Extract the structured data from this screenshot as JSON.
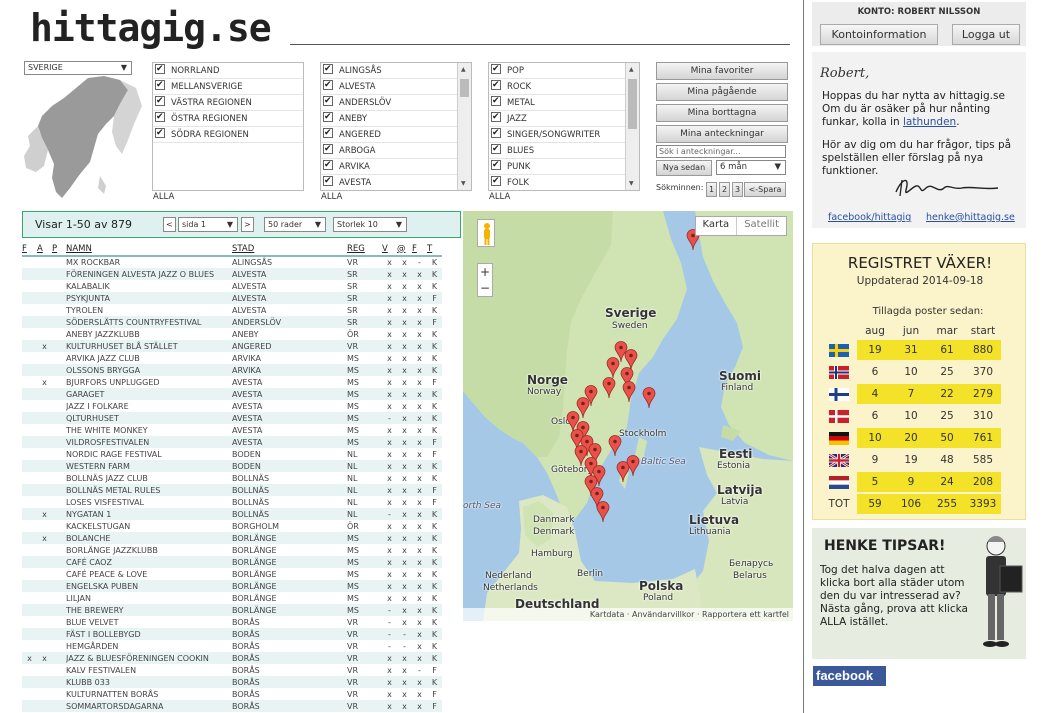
{
  "logo": "hittagig.se",
  "country_select": "SVERIGE",
  "regions": [
    "NORRLAND",
    "MELLANSVERIGE",
    "VÄSTRA REGIONEN",
    "ÖSTRA REGIONEN",
    "SÖDRA REGIONEN"
  ],
  "cities": [
    "ALINGSÅS",
    "ALVESTA",
    "ANDERSLÖV",
    "ANEBY",
    "ANGERED",
    "ARBOGA",
    "ARVIKA",
    "AVESTA"
  ],
  "genres": [
    "POP",
    "ROCK",
    "METAL",
    "JAZZ",
    "SINGER/SONGWRITER",
    "BLUES",
    "PUNK",
    "FOLK"
  ],
  "alla": "ALLA",
  "side_buttons": [
    "Mina favoriter",
    "Mina pågående",
    "Mina borttagna",
    "Mina anteckningar"
  ],
  "notes_search_placeholder": "Sök i anteckningar...",
  "nya_sedan": "Nya sedan",
  "period_select": "6 mån",
  "sokminnen_label": "Sökminnen:",
  "sokminnen_pages": [
    "1",
    "2",
    "3"
  ],
  "spara": "<-Spara",
  "listbar": {
    "showing": "Visar 1-50 av 879",
    "prev": "<",
    "page": "sida 1",
    "next": ">",
    "rows": "50 rader",
    "size": "Storlek 10"
  },
  "table_headers": [
    "F",
    "A",
    "P",
    "NAMN",
    "STAD",
    "REG",
    "V",
    "@",
    "F",
    "T"
  ],
  "gigs": [
    [
      "",
      "",
      "",
      "MX ROCKBAR",
      "ALINGSÅS",
      "VR",
      "x",
      "x",
      "-",
      "x",
      "K"
    ],
    [
      "",
      "",
      "",
      "FÖRENINGEN ALVESTA JAZZ O BLUES",
      "ALVESTA",
      "SR",
      "x",
      "x",
      "x",
      "x",
      "K"
    ],
    [
      "",
      "",
      "",
      "KALABALIK",
      "ALVESTA",
      "SR",
      "x",
      "x",
      "x",
      "-",
      "K"
    ],
    [
      "",
      "",
      "",
      "PSYKJUNTA",
      "ALVESTA",
      "SR",
      "x",
      "x",
      "x",
      "-",
      "F"
    ],
    [
      "",
      "",
      "",
      "TYROLEN",
      "ALVESTA",
      "SR",
      "x",
      "x",
      "x",
      "X",
      "K"
    ],
    [
      "",
      "",
      "",
      "SÖDERSLÄTTS COUNTRYFESTIVAL",
      "ANDERSLÖV",
      "SR",
      "x",
      "x",
      "x",
      "-",
      "F"
    ],
    [
      "",
      "",
      "",
      "ANEBY JAZZKLUBB",
      "ANEBY",
      "ÖR",
      "x",
      "x",
      "x",
      "-",
      "K"
    ],
    [
      "",
      "x",
      "",
      "KULTURHUSET BLÅ STÄLLET",
      "ANGERED",
      "VR",
      "x",
      "x",
      "x",
      "x",
      "K"
    ],
    [
      "",
      "",
      "",
      "ARVIKA JAZZ CLUB",
      "ARVIKA",
      "MS",
      "x",
      "x",
      "x",
      "-",
      "K"
    ],
    [
      "",
      "",
      "",
      "OLSSONS BRYGGA",
      "ARVIKA",
      "MS",
      "x",
      "x",
      "x",
      "-",
      "K"
    ],
    [
      "",
      "x",
      "",
      "BJURFORS UNPLUGGED",
      "AVESTA",
      "MS",
      "x",
      "x",
      "x",
      "x",
      "F"
    ],
    [
      "",
      "",
      "",
      "GARAGET",
      "AVESTA",
      "MS",
      "x",
      "x",
      "x",
      "-",
      "K"
    ],
    [
      "",
      "",
      "",
      "JAZZ I FOLKARE",
      "AVESTA",
      "MS",
      "x",
      "x",
      "x",
      "-",
      "K"
    ],
    [
      "",
      "",
      "",
      "QLTURHUSET",
      "AVESTA",
      "MS",
      "-",
      "x",
      "x",
      "-",
      "K"
    ],
    [
      "",
      "",
      "",
      "THE WHITE MONKEY",
      "AVESTA",
      "MS",
      "x",
      "x",
      "x",
      "x",
      "K"
    ],
    [
      "",
      "",
      "",
      "VILDROSFESTIVALEN",
      "AVESTA",
      "MS",
      "x",
      "x",
      "x",
      "-",
      "F"
    ],
    [
      "",
      "",
      "",
      "NORDIC RAGE FESTIVAL",
      "BODEN",
      "NL",
      "x",
      "x",
      "x",
      "-",
      "F"
    ],
    [
      "",
      "",
      "",
      "WESTERN FARM",
      "BODEN",
      "NL",
      "x",
      "x",
      "x",
      "-",
      "K"
    ],
    [
      "",
      "",
      "",
      "BOLLNÄS JAZZ CLUB",
      "BOLLNÄS",
      "NL",
      "x",
      "x",
      "x",
      "-",
      "K"
    ],
    [
      "",
      "",
      "",
      "BOLLNÄS METAL RULES",
      "BOLLNÄS",
      "NL",
      "x",
      "x",
      "x",
      "-",
      "F"
    ],
    [
      "",
      "",
      "",
      "LOSES VISFESTIVAL",
      "BOLLNÄS",
      "NL",
      "x",
      "x",
      "x",
      "-",
      "F"
    ],
    [
      "",
      "x",
      "",
      "NYGATAN 1",
      "BOLLNÄS",
      "NL",
      "-",
      "x",
      "x",
      "x",
      "K"
    ],
    [
      "",
      "",
      "",
      "KACKELSTUGAN",
      "BORGHOLM",
      "ÖR",
      "x",
      "x",
      "x",
      "X",
      "K"
    ],
    [
      "",
      "x",
      "",
      "BOLANCHE",
      "BORLÄNGE",
      "MS",
      "x",
      "x",
      "x",
      "x",
      "K"
    ],
    [
      "",
      "",
      "",
      "BORLÄNGE JAZZKLUBB",
      "BORLÄNGE",
      "MS",
      "x",
      "x",
      "x",
      "-",
      "K"
    ],
    [
      "",
      "",
      "",
      "CAFÉ CAOZ",
      "BORLÄNGE",
      "MS",
      "x",
      "x",
      "x",
      "-",
      "K"
    ],
    [
      "",
      "",
      "",
      "CAFÉ PEACE & LOVE",
      "BORLÄNGE",
      "MS",
      "x",
      "x",
      "x",
      "-",
      "K"
    ],
    [
      "",
      "",
      "",
      "ENGELSKA PUBEN",
      "BORLÄNGE",
      "MS",
      "x",
      "x",
      "x",
      "-",
      "K"
    ],
    [
      "",
      "",
      "",
      "LILJAN",
      "BORLÄNGE",
      "MS",
      "x",
      "x",
      "x",
      "x",
      "K"
    ],
    [
      "",
      "",
      "",
      "THE BREWERY",
      "BORLÄNGE",
      "MS",
      "-",
      "x",
      "x",
      "-",
      "K"
    ],
    [
      "",
      "",
      "",
      "BLUE VELVET",
      "BORÅS",
      "VR",
      "-",
      "x",
      "x",
      "-",
      "K"
    ],
    [
      "",
      "",
      "",
      "FÄST I BOLLEBYGD",
      "BORÅS",
      "VR",
      "-",
      "-",
      "x",
      "-",
      "K"
    ],
    [
      "",
      "",
      "",
      "HEMGÅRDEN",
      "BORÅS",
      "VR",
      "-",
      "-",
      "x",
      "-",
      "K"
    ],
    [
      "x",
      "x",
      "",
      "JAZZ & BLUESFÖRENINGEN COOKIN",
      "BORÅS",
      "VR",
      "x",
      "x",
      "x",
      "x",
      "K"
    ],
    [
      "",
      "",
      "",
      "KALV FESTIVALEN",
      "BORÅS",
      "VR",
      "x",
      "x",
      "-",
      "-",
      "F"
    ],
    [
      "",
      "",
      "",
      "KLUBB 033",
      "BORÅS",
      "VR",
      "x",
      "x",
      "x",
      "-",
      "K"
    ],
    [
      "",
      "",
      "",
      "KULTURNATTEN BORÅS",
      "BORÅS",
      "VR",
      "x",
      "x",
      "x",
      "-",
      "F"
    ],
    [
      "",
      "",
      "",
      "SOMMARTORSDAGARNA",
      "BORÅS",
      "VR",
      "x",
      "x",
      "x",
      "-",
      "F"
    ]
  ],
  "map": {
    "type_map": "Karta",
    "type_sat": "Satellit",
    "zoom_in": "+",
    "zoom_out": "−",
    "labels": {
      "sverige": "Sverige",
      "sweden": "Sweden",
      "norge": "Norge",
      "norway": "Norway",
      "suomi": "Suomi",
      "finland": "Finland",
      "oslo": "Oslo",
      "stockholm": "Stockholm",
      "goteborg": "Göteborg",
      "baltic": "Baltic Sea",
      "eesti": "Eesti",
      "estonia": "Estonia",
      "latvija": "Latvija",
      "latvia": "Latvia",
      "lietuva": "Lietuva",
      "lithuania": "Lithuania",
      "danmark": "Danmark",
      "denmark": "Denmark",
      "hamburg": "Hamburg",
      "berlin": "Berlin",
      "nederland": "Nederland",
      "netherlands": "Netherlands",
      "polska": "Polska",
      "poland": "Poland",
      "deutschland": "Deutschland",
      "belarus": "Беларусь",
      "belarus_en": "Belarus",
      "north_sea": "orth Sea"
    },
    "footer": "Kartdata · Användarvillkor · Rapportera ett kartfel"
  },
  "account": {
    "label": "KONTO: ROBERT NILSSON",
    "info_button": "Kontoinformation",
    "logout_button": "Logga ut"
  },
  "note": {
    "greeting": "Robert,",
    "p1_start": "Hoppas du har nytta av hittagig.se Om du är osäker på hur nånting funkar, kolla in ",
    "p1_link": "lathunden",
    "p1_end": ".",
    "p2": "Hör av dig om du har frågor, tips på spelställen eller förslag på nya funktioner.",
    "link_fb": "facebook/hittagig",
    "link_mail": "henke@hittagig.se"
  },
  "registry": {
    "title": "REGISTRET VÄXER!",
    "updated": "Uppdaterad 2014-09-18",
    "subtitle": "Tillagda poster sedan:",
    "cols": [
      "aug",
      "jun",
      "mar",
      "start"
    ],
    "rows": [
      {
        "flag": "se",
        "v": [
          "19",
          "31",
          "61",
          "880"
        ]
      },
      {
        "flag": "no",
        "v": [
          "6",
          "10",
          "25",
          "370"
        ]
      },
      {
        "flag": "fi",
        "v": [
          "4",
          "7",
          "22",
          "279"
        ]
      },
      {
        "flag": "dk",
        "v": [
          "6",
          "10",
          "25",
          "310"
        ]
      },
      {
        "flag": "de",
        "v": [
          "10",
          "20",
          "50",
          "761"
        ]
      },
      {
        "flag": "uk",
        "v": [
          "9",
          "19",
          "48",
          "585"
        ]
      },
      {
        "flag": "nl",
        "v": [
          "5",
          "9",
          "24",
          "208"
        ]
      }
    ],
    "total_label": "TOT",
    "total": [
      "59",
      "106",
      "255",
      "3393"
    ]
  },
  "tips": {
    "title": "HENKE TIPSAR!",
    "text": "Tog det halva dagen att klicka bort alla städer utom den du var intresserad av? Nästa gång, prova att klicka ALLA istället."
  },
  "facebook": "facebook"
}
